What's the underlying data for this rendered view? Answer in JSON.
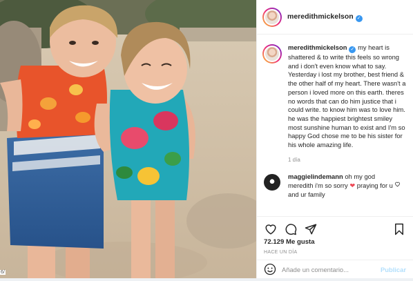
{
  "post": {
    "username": "meredithmickelson",
    "caption": "my heart is shattered & to write this feels so wrong and i don't even know what to say. Yesterday i lost my brother, best friend & the other half of my heart. There wasn't a person i loved more on this earth. theres no words that can do him justice that i could write. to know him was to love him. he was the happiest brightest smiley most sunshine human to exist and I'm so happy God chose me to be his sister for his whole amazing life.",
    "caption_time": "1 día",
    "likes": "72.129 Me gusta",
    "date": "HACE UN DÍA"
  },
  "comment": {
    "username": "maggielindemann",
    "text_before": "oh my god meredith i'm so sorry ",
    "heart_emoji": "❤",
    "text_after": " praying for u and ur family"
  },
  "add_comment": {
    "placeholder": "Añade un comentario...",
    "publish_label": "Publicar"
  },
  "fragment": "6/",
  "icons": {
    "like": "heart-icon",
    "comment": "comment-icon",
    "share": "paper-plane-icon",
    "save": "bookmark-icon",
    "emoji": "smiley-icon",
    "verified": "verified-badge-icon"
  },
  "colors": {
    "verified_blue": "#3897f0",
    "publish_disabled": "#b2dffc",
    "heart_red": "#ed4956",
    "meta_gray": "#8e8e8e"
  }
}
